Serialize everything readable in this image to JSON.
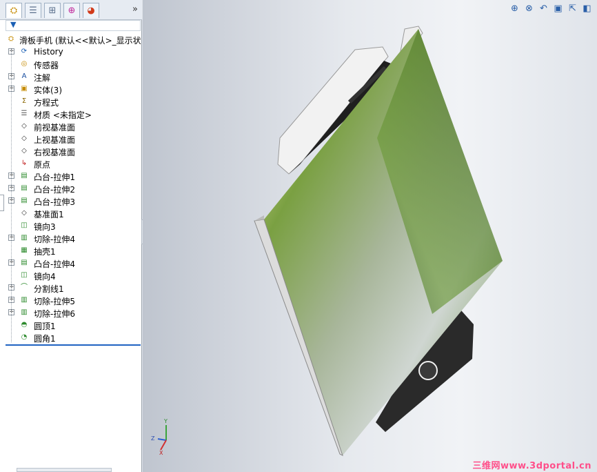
{
  "toolbar_tabs": [
    {
      "icon": "feature-manager-icon",
      "active": true
    },
    {
      "icon": "property-manager-icon",
      "active": false
    },
    {
      "icon": "configuration-manager-icon",
      "active": false
    },
    {
      "icon": "dimxpert-manager-icon",
      "active": false
    },
    {
      "icon": "display-manager-icon",
      "active": false
    }
  ],
  "expand_label": "»",
  "root": {
    "label": "滑板手机 (默认<<默认>_显示状"
  },
  "tree": [
    {
      "label": "History",
      "icon": "history-icon",
      "expand": true
    },
    {
      "label": "传感器",
      "icon": "sensor-icon",
      "expand": false
    },
    {
      "label": "注解",
      "icon": "annotation-icon",
      "expand": true
    },
    {
      "label": "实体(3)",
      "icon": "solid-bodies-icon",
      "expand": true
    },
    {
      "label": "方程式",
      "icon": "equation-icon",
      "expand": false
    },
    {
      "label": "材质 <未指定>",
      "icon": "material-icon",
      "expand": false
    },
    {
      "label": "前视基准面",
      "icon": "plane-icon",
      "expand": false
    },
    {
      "label": "上视基准面",
      "icon": "plane-icon",
      "expand": false
    },
    {
      "label": "右视基准面",
      "icon": "plane-icon",
      "expand": false
    },
    {
      "label": "原点",
      "icon": "origin-icon",
      "expand": false
    },
    {
      "label": "凸台-拉伸1",
      "icon": "extrude-icon",
      "expand": true
    },
    {
      "label": "凸台-拉伸2",
      "icon": "extrude-icon",
      "expand": true
    },
    {
      "label": "凸台-拉伸3",
      "icon": "extrude-icon",
      "expand": true
    },
    {
      "label": "基准面1",
      "icon": "plane-icon",
      "expand": false
    },
    {
      "label": "镜向3",
      "icon": "mirror-icon",
      "expand": false
    },
    {
      "label": "切除-拉伸4",
      "icon": "cut-extrude-icon",
      "expand": true
    },
    {
      "label": "抽壳1",
      "icon": "shell-icon",
      "expand": false
    },
    {
      "label": "凸台-拉伸4",
      "icon": "extrude-icon",
      "expand": true
    },
    {
      "label": "镜向4",
      "icon": "mirror-icon",
      "expand": false
    },
    {
      "label": "分割线1",
      "icon": "split-line-icon",
      "expand": true
    },
    {
      "label": "切除-拉伸5",
      "icon": "cut-extrude-icon",
      "expand": true
    },
    {
      "label": "切除-拉伸6",
      "icon": "cut-extrude-icon",
      "expand": true
    },
    {
      "label": "圆顶1",
      "icon": "dome-icon",
      "expand": false
    },
    {
      "label": "圆角1",
      "icon": "fillet-icon",
      "expand": false
    }
  ],
  "view_tools": [
    {
      "icon": "zoom-to-fit-icon",
      "glyph": "⊕"
    },
    {
      "icon": "zoom-to-area-icon",
      "glyph": "⊗"
    },
    {
      "icon": "previous-view-icon",
      "glyph": "↶"
    },
    {
      "icon": "section-view-icon",
      "glyph": "▣"
    },
    {
      "icon": "view-orientation-icon",
      "glyph": "⇱"
    },
    {
      "icon": "display-style-icon",
      "glyph": "◧"
    }
  ],
  "triad": {
    "x": "X",
    "y": "Y",
    "z": "Z"
  },
  "watermark": "三维网www.3dportal.cn"
}
